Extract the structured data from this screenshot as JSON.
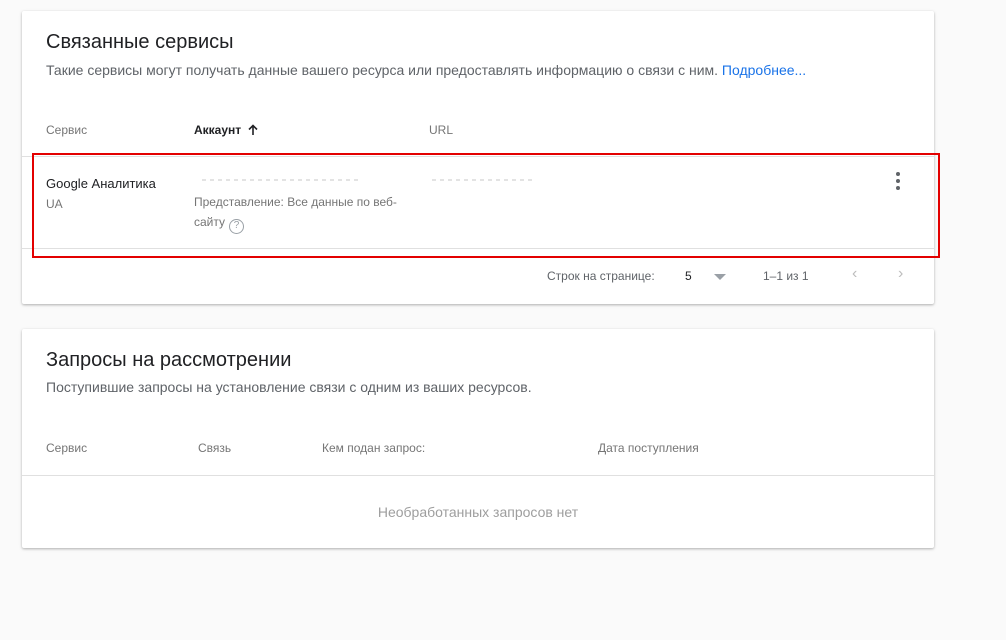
{
  "linked_services": {
    "title": "Связанные сервисы",
    "subtitle": "Такие сервисы могут получать данные вашего ресурса или предоставлять информацию о связи с ним.",
    "learn_more": "Подробнее...",
    "columns": {
      "service": "Сервис",
      "account": "Аккаунт",
      "url": "URL"
    },
    "rows": [
      {
        "service_name": "Google Аналитика",
        "service_type": "UA",
        "view": "Представление: Все данные по веб-сайту"
      }
    ],
    "pagination": {
      "rows_per_page_label": "Строк на странице:",
      "rows_per_page_value": "5",
      "range": "1–1 из 1"
    }
  },
  "pending_requests": {
    "title": "Запросы на рассмотрении",
    "subtitle": "Поступившие запросы на установление связи с одним из ваших ресурсов.",
    "columns": {
      "service": "Сервис",
      "link": "Связь",
      "requested_by": "Кем подан запрос:",
      "date": "Дата поступления"
    },
    "empty_message": "Необработанных запросов нет"
  }
}
